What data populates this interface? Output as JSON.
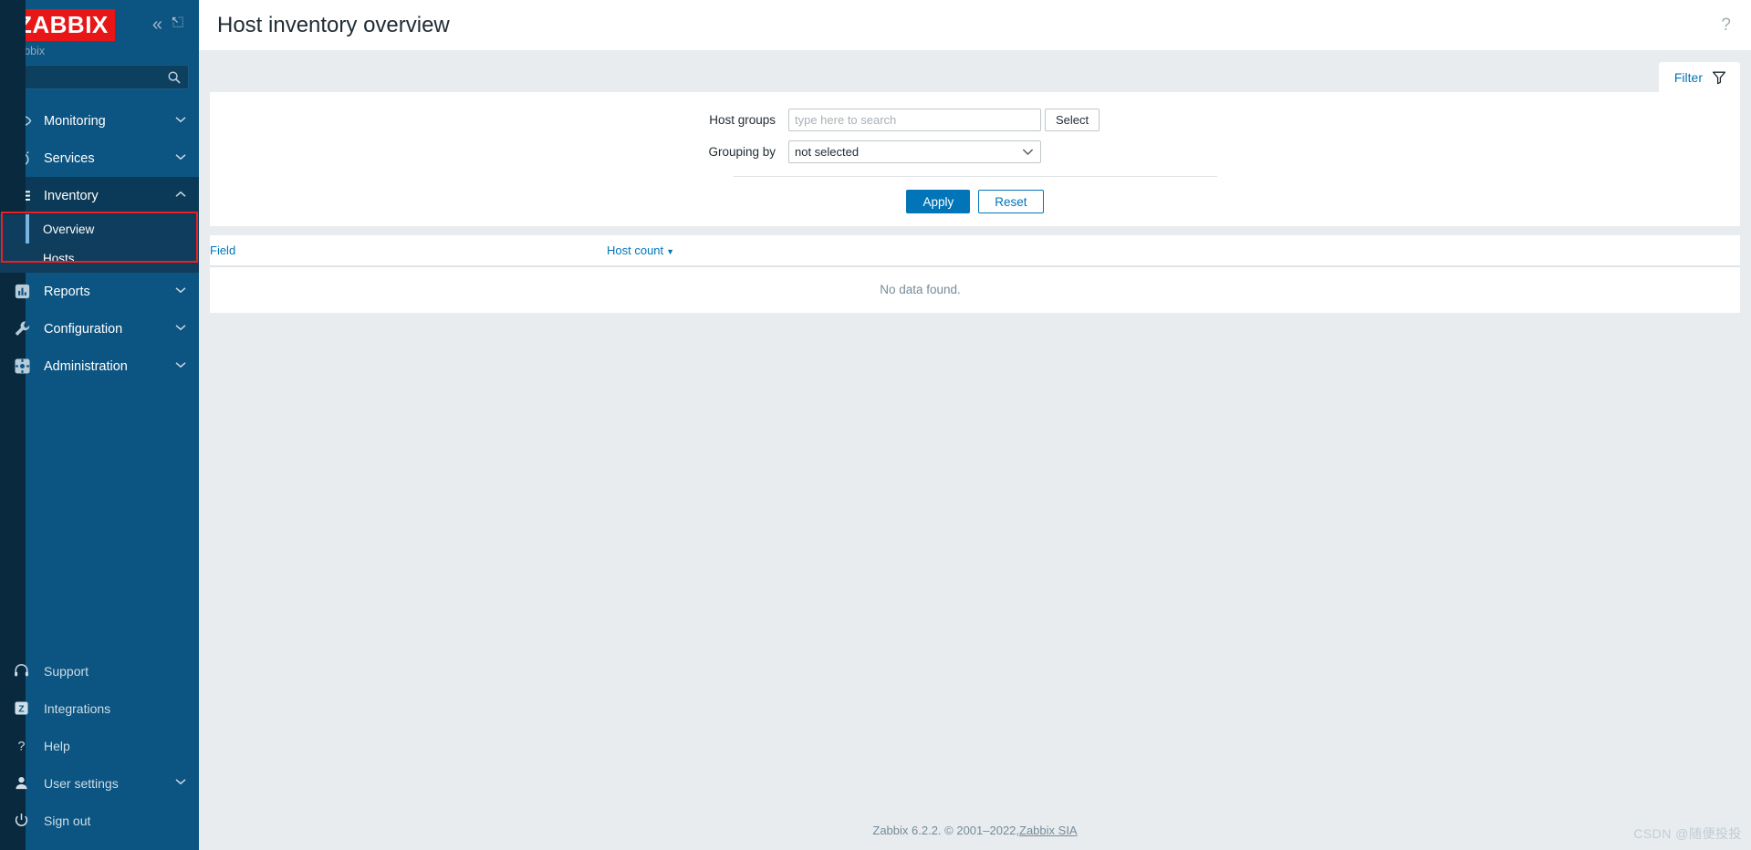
{
  "sidebar": {
    "logo_text": "ZABBIX",
    "server_name": "zabbix",
    "collapse_icon": "chevron-double-left-icon",
    "hide_icon": "collapse-sidebar-icon",
    "search": {
      "value": "",
      "placeholder": "",
      "icon": "search-icon"
    },
    "items": [
      {
        "label": "Monitoring",
        "icon": "eye-icon",
        "chevron": "chevron-down-icon",
        "expanded": false
      },
      {
        "label": "Services",
        "icon": "stopwatch-icon",
        "chevron": "chevron-down-icon",
        "expanded": false
      },
      {
        "label": "Inventory",
        "icon": "list-icon",
        "chevron": "chevron-up-icon",
        "expanded": true
      },
      {
        "label": "Reports",
        "icon": "bar-chart-icon",
        "chevron": "chevron-down-icon",
        "expanded": false
      },
      {
        "label": "Configuration",
        "icon": "wrench-icon",
        "chevron": "chevron-down-icon",
        "expanded": false
      },
      {
        "label": "Administration",
        "icon": "gear-icon",
        "chevron": "chevron-down-icon",
        "expanded": false
      }
    ],
    "inventory_submenu": [
      {
        "label": "Overview",
        "active": true
      },
      {
        "label": "Hosts",
        "active": false
      }
    ],
    "bottom_items": [
      {
        "label": "Support",
        "icon": "headset-icon",
        "chevron": ""
      },
      {
        "label": "Integrations",
        "icon": "zabbix-z-icon",
        "chevron": ""
      },
      {
        "label": "Help",
        "icon": "question-mark-icon",
        "chevron": ""
      },
      {
        "label": "User settings",
        "icon": "user-icon",
        "chevron": "chevron-down-icon"
      },
      {
        "label": "Sign out",
        "icon": "power-icon",
        "chevron": ""
      }
    ]
  },
  "header": {
    "title": "Host inventory overview",
    "help_icon": "question-mark-icon"
  },
  "filter": {
    "tab_label": "Filter",
    "tab_icon": "funnel-icon",
    "host_groups": {
      "label": "Host groups",
      "value": "",
      "placeholder": "type here to search",
      "select_button": "Select"
    },
    "grouping_by": {
      "label": "Grouping by",
      "value": "not selected",
      "caret_icon": "chevron-down-icon"
    },
    "apply_label": "Apply",
    "reset_label": "Reset"
  },
  "table": {
    "columns": [
      {
        "label": "Field",
        "sorted": false
      },
      {
        "label": "Host count",
        "sorted": true,
        "sort_icon": "sort-desc-caret"
      }
    ],
    "empty_message": "No data found."
  },
  "footer": {
    "text": "Zabbix 6.2.2. © 2001–2022, ",
    "link": "Zabbix SIA"
  },
  "watermark": {
    "text": "CSDN @随便投投"
  },
  "colors": {
    "sidebar_bg": "#0c5481",
    "logo_red": "#e81616",
    "accent_blue": "#0275b8",
    "annotation_red": "#ef1f1f",
    "content_bg": "#e8ecef"
  }
}
